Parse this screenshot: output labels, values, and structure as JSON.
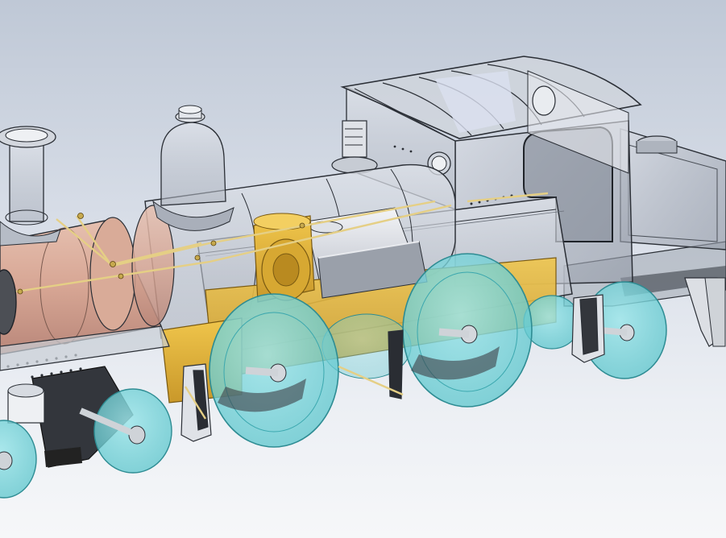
{
  "scene": {
    "subject": "",
    "palette": {
      "background_top": "#bfc8d6",
      "background_bottom": "#f6f7f9",
      "wheel_fill": "#6fd3d8",
      "wheel_stroke": "#2e8c93",
      "frame_yellow": "#e2b43a",
      "boiler_copper": "#d7a694",
      "glass_fill": "#c9ced6",
      "edge_dark": "#2b2f36",
      "axle_grey": "#cfd3d8",
      "brass_pipe": "#e5cf85"
    }
  }
}
